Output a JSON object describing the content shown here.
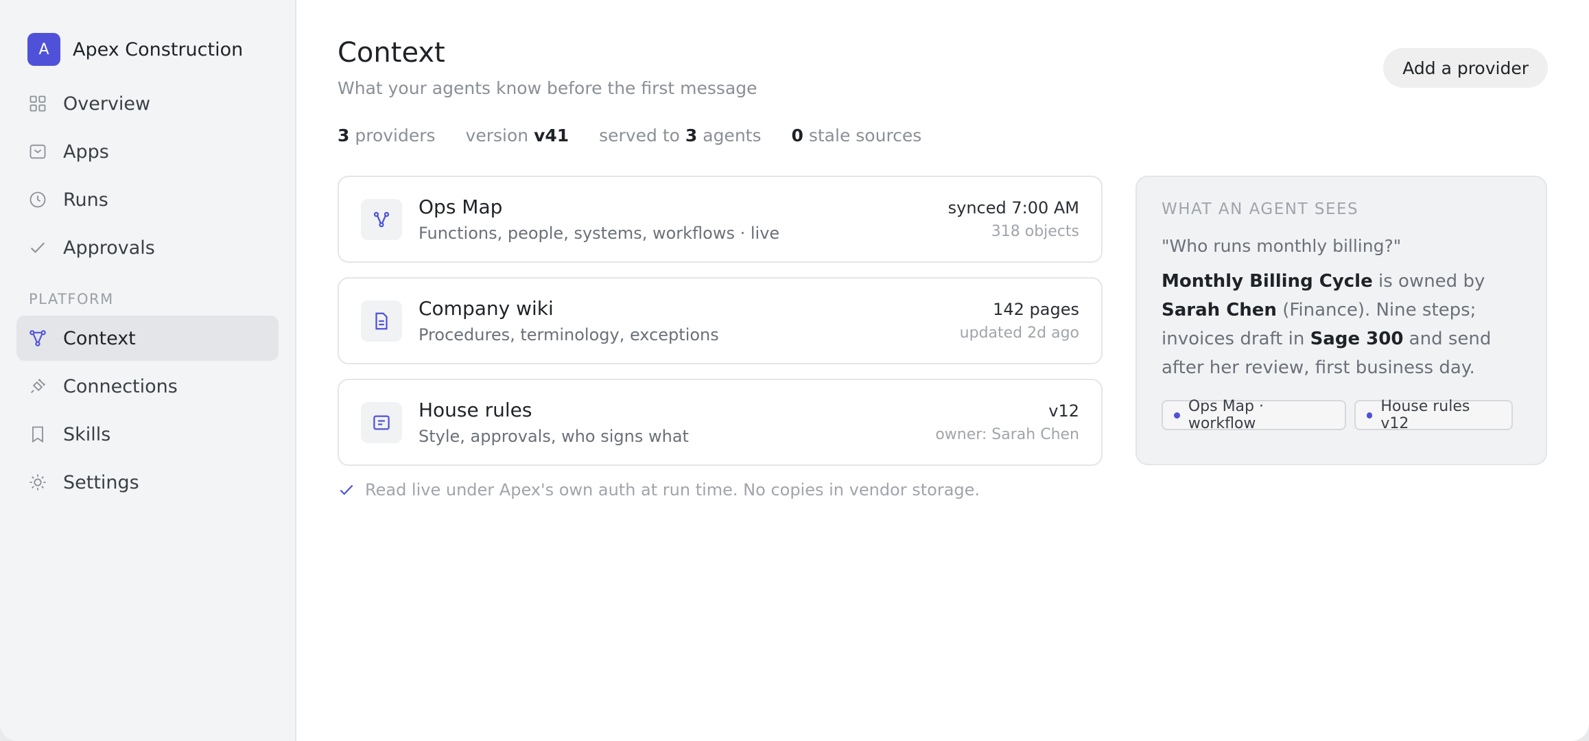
{
  "brand": {
    "initial": "A",
    "name": "Apex Construction"
  },
  "colors": {
    "accent": "#4f52d9",
    "sidebar_bg": "#f3f4f6",
    "active_bg": "#e4e5e8"
  },
  "nav": {
    "primary": [
      {
        "label": "Overview",
        "icon": "grid-icon"
      },
      {
        "label": "Apps",
        "icon": "inbox-icon"
      },
      {
        "label": "Runs",
        "icon": "clock-icon"
      },
      {
        "label": "Approvals",
        "icon": "check-icon"
      }
    ],
    "section_label": "PLATFORM",
    "platform": [
      {
        "label": "Context",
        "icon": "nodes-icon",
        "active": true
      },
      {
        "label": "Connections",
        "icon": "plug-icon"
      },
      {
        "label": "Skills",
        "icon": "bookmark-icon"
      },
      {
        "label": "Settings",
        "icon": "sun-gear-icon"
      }
    ]
  },
  "header": {
    "title": "Context",
    "subtitle": "What your agents know before the first message",
    "add_button": "Add a provider"
  },
  "stats": [
    {
      "value": "3",
      "label": " providers",
      "value_first": true
    },
    {
      "prefix": "version ",
      "value": "v41"
    },
    {
      "prefix": "served to ",
      "value": "3",
      "suffix": " agents"
    },
    {
      "value": "0",
      "label": " stale sources",
      "value_first": true
    }
  ],
  "providers": [
    {
      "title": "Ops Map",
      "desc": "Functions, people, systems, workflows · live",
      "meta_top": "synced 7:00 AM",
      "meta_bottom": "318 objects",
      "icon": "nodes-icon"
    },
    {
      "title": "Company wiki",
      "desc": "Procedures, terminology, exceptions",
      "meta_top": "142 pages",
      "meta_bottom": "updated 2d ago",
      "icon": "document-icon"
    },
    {
      "title": "House rules",
      "desc": "Style, approvals, who signs what",
      "meta_top": "v12",
      "meta_bottom": "owner: Sarah Chen",
      "icon": "rules-icon"
    }
  ],
  "footnote": "Read live under Apex's own auth at run time. No copies in vendor storage.",
  "agent_view": {
    "title": "WHAT AN AGENT SEES",
    "question": "\"Who runs monthly billing?\"",
    "answer": {
      "b1": "Monthly Billing Cycle",
      "t1": " is owned by ",
      "b2": "Sarah Chen",
      "t2": " (Finance). Nine steps; invoices draft in ",
      "b3": "Sage 300",
      "t3": " and send after her review, first business day."
    },
    "tags": [
      "Ops Map · workflow",
      "House rules v12"
    ]
  }
}
